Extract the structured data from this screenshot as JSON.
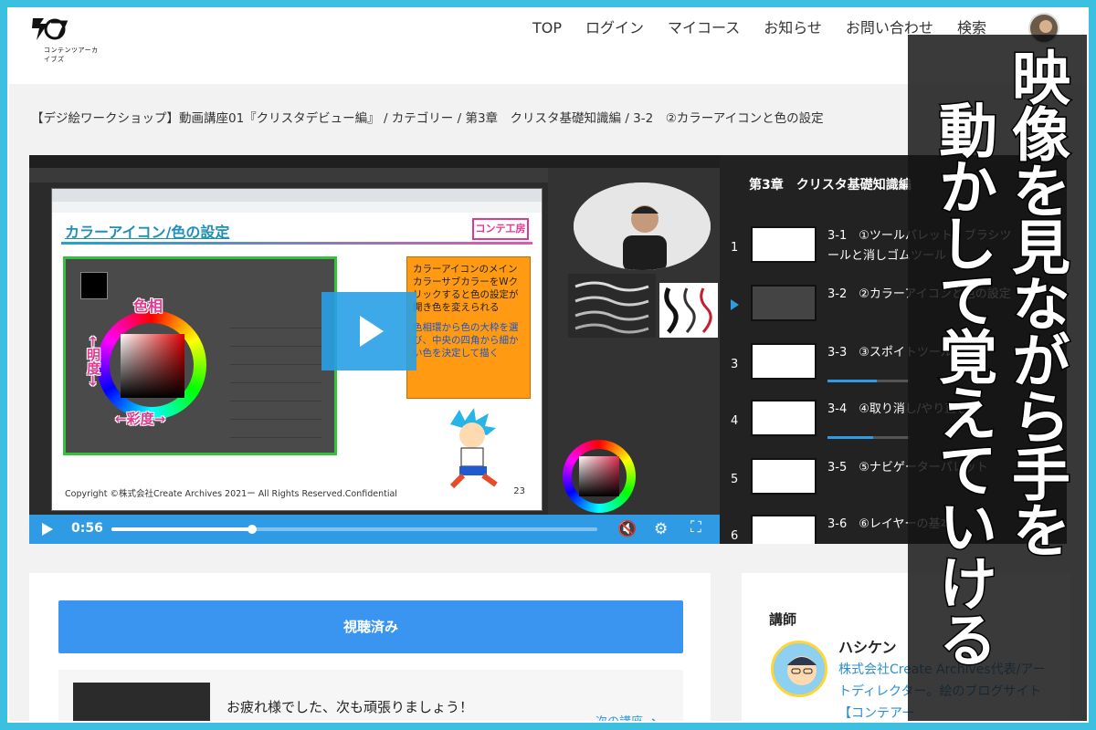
{
  "header": {
    "logo_text": "コンテンツアーカイブズ",
    "nav": [
      "TOP",
      "ログイン",
      "マイコース",
      "お知らせ",
      "お問い合わせ",
      "検索"
    ]
  },
  "breadcrumb": "【デジ絵ワークショップ】動画講座01『クリスタデビュー編』 / カテゴリー / 第3章　クリスタ基礎知識編 / 3-2　②カラーアイコンと色の設定",
  "video": {
    "slide": {
      "title_part1": "カラーアイコン",
      "title_sep": "/",
      "title_part2": "色の設定",
      "logo": "コンテ工房",
      "label_hue": "色相",
      "label_brightness": "←明度→",
      "label_saturation": "←彩度→",
      "orange_text_1": "カラーアイコンのメインカラーサブカラーをWクリックすると色の設定が開き色を変えられる",
      "orange_text_2": "色相環から色の大枠を選び、中央の四角から細かい色を決定して描く",
      "copyright": "Copyright ©株式会社Create Archives 2021ー All Rights Reserved.Confidential",
      "page": "23"
    },
    "time": "0:56",
    "progress": 0.29
  },
  "playlist": {
    "title": "第3章　クリスタ基礎知識編",
    "items": [
      {
        "num": "1",
        "label": "3-1　①ツールパレット、ブラシツールと消しゴムツール",
        "progress": 0
      },
      {
        "num": "",
        "label": "3-2　②カラーアイコンと色の設定",
        "progress": 0
      },
      {
        "num": "3",
        "label": "3-3　③スポイトツール",
        "progress": 0.6
      },
      {
        "num": "4",
        "label": "3-4　④取り消し/やり直し",
        "progress": 0.55
      },
      {
        "num": "5",
        "label": "3-5　⑤ナビゲーターパレット",
        "progress": 0
      },
      {
        "num": "6",
        "label": "3-6　⑥レイヤーの基本",
        "progress": 0
      }
    ]
  },
  "main": {
    "watched_label": "視聴済み",
    "next_message": "お疲れ様でした、次も頑張りましょう！",
    "next_link": "次の講座 ➜"
  },
  "instructor": {
    "heading": "講師",
    "name": "ハシケン",
    "bio": "株式会社Create Archives代表/アートディレクター。絵のブログサイト【コンテアー"
  },
  "banner": {
    "line1": "映像を見ながら手を",
    "line2": "動かして覚えていける"
  }
}
